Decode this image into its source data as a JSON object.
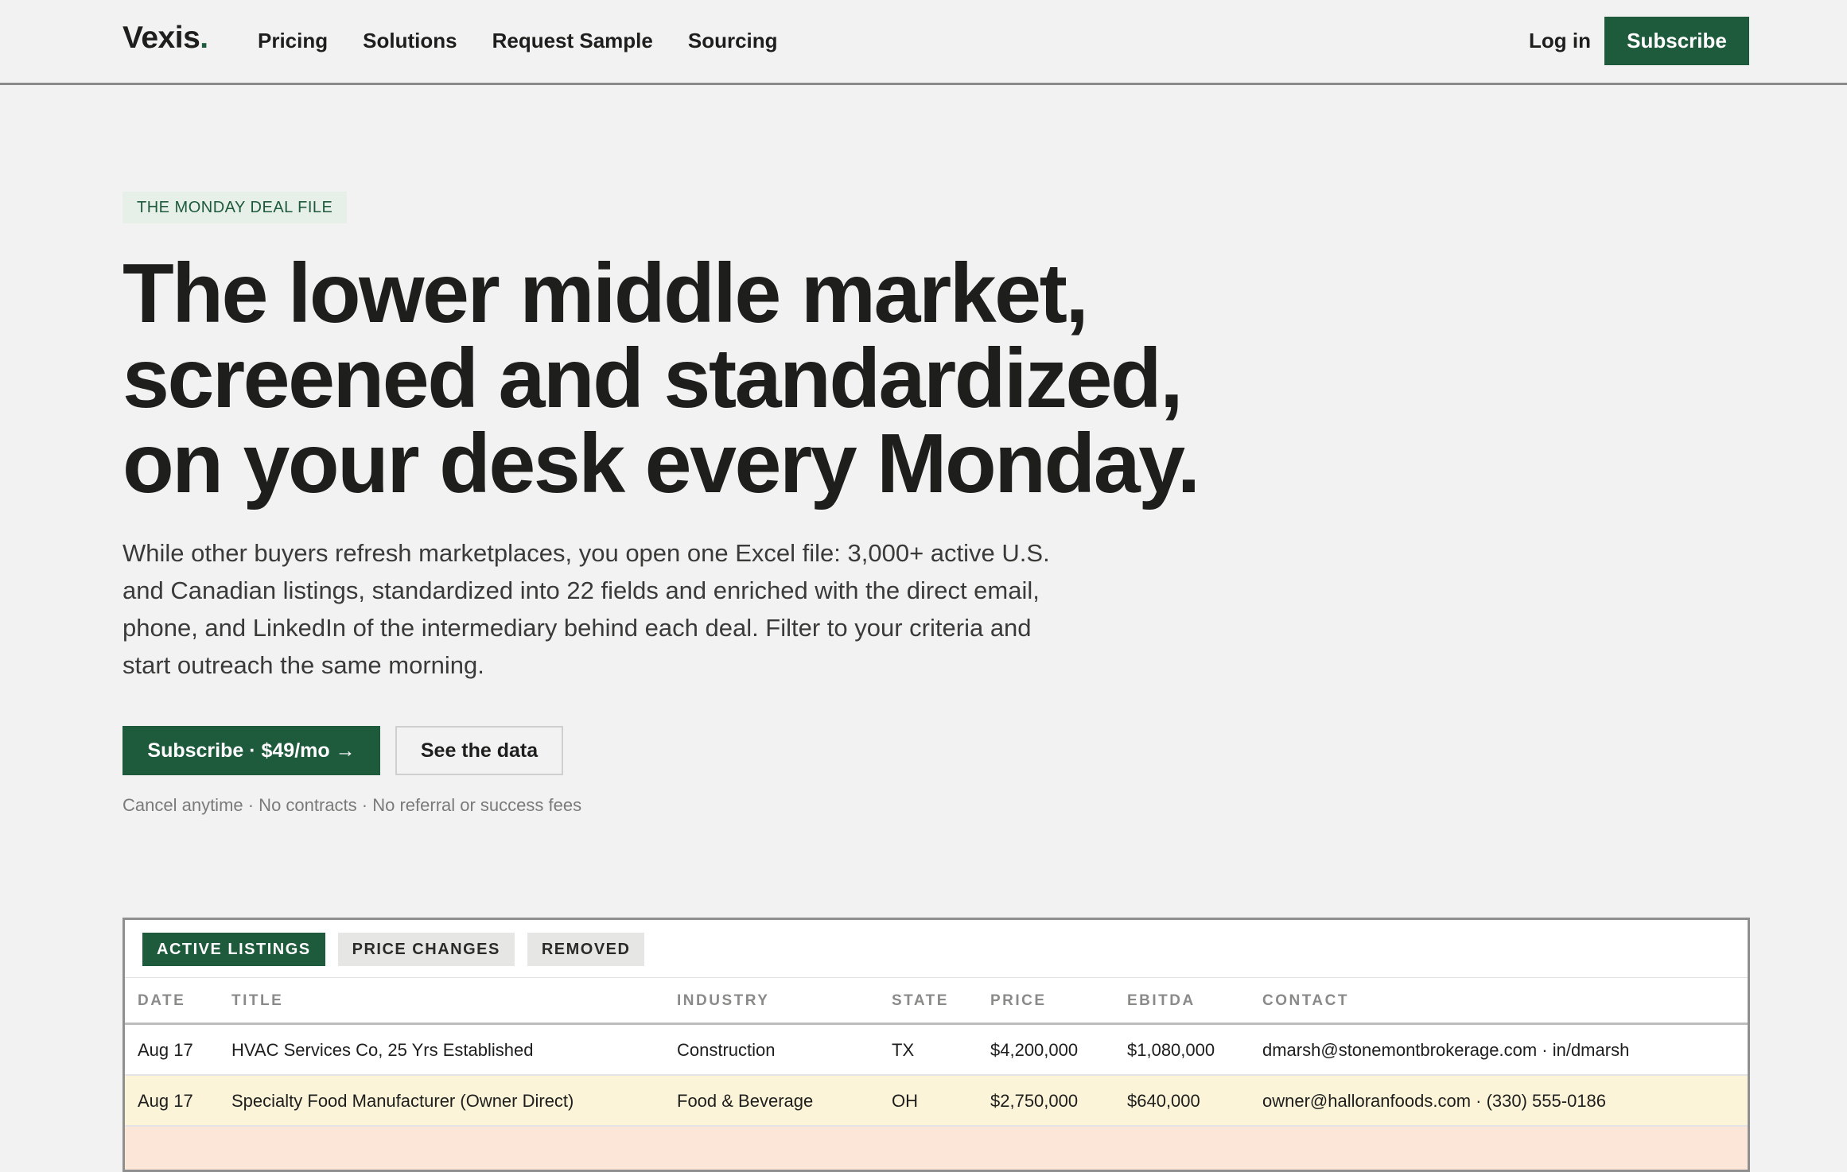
{
  "header": {
    "logo": "Vexis",
    "logo_dot": ".",
    "nav": [
      "Pricing",
      "Solutions",
      "Request Sample",
      "Sourcing"
    ],
    "login": "Log in",
    "subscribe": "Subscribe"
  },
  "hero": {
    "eyebrow": "THE MONDAY DEAL FILE",
    "headline_lines": [
      "The lower middle market,",
      "screened and standardized,",
      "on your desk every Monday."
    ],
    "lead": "While other buyers refresh marketplaces, you open one Excel file: 3,000+ active U.S. and Canadian listings, standardized into 22 fields and enriched with the direct email, phone, and LinkedIn of the intermediary behind each deal. Filter to your criteria and start outreach the same morning.",
    "cta_primary": "Subscribe · $49/mo →",
    "cta_secondary": "See the data",
    "fineprint": "Cancel anytime · No contracts · No referral or success fees"
  },
  "table": {
    "tabs": [
      "ACTIVE LISTINGS",
      "PRICE CHANGES",
      "REMOVED"
    ],
    "active_tab": "ACTIVE LISTINGS",
    "columns": [
      "DATE",
      "TITLE",
      "INDUSTRY",
      "STATE",
      "PRICE",
      "EBITDA",
      "CONTACT"
    ],
    "rows": [
      {
        "date": "Aug 17",
        "title": "HVAC Services Co, 25 Yrs Established",
        "industry": "Construction",
        "state": "TX",
        "price": "$4,200,000",
        "ebitda": "$1,080,000",
        "contact": "dmarsh@stonemontbrokerage.com · in/dmarsh"
      },
      {
        "date": "Aug 17",
        "title": "Specialty Food Manufacturer (Owner Direct)",
        "industry": "Food & Beverage",
        "state": "OH",
        "price": "$2,750,000",
        "ebitda": "$640,000",
        "contact": "owner@halloranfoods.com · (330) 555-0186"
      }
    ]
  },
  "colors": {
    "brand_green": "#1e5a3c",
    "page_bg": "#f2f2f2",
    "row_highlight_yellow": "#fcf4d9",
    "row_highlight_peach": "#fbe6d8"
  }
}
